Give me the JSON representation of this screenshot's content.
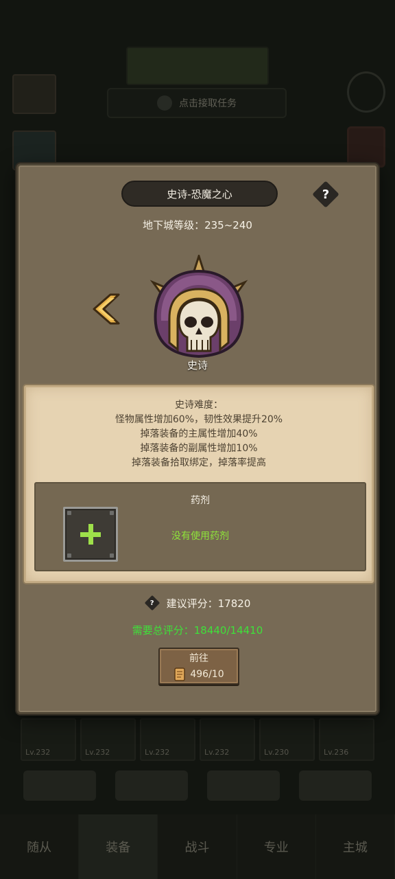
{
  "background": {
    "top_panel_text": [
      "",
      ""
    ],
    "task_bar_text": "点击接取任务",
    "equipment_slots": [
      "Lv.232",
      "Lv.232",
      "Lv.232",
      "Lv.232",
      "Lv.230",
      "Lv.236"
    ],
    "nav_items": [
      "随从",
      "装备",
      "战斗",
      "专业",
      "主城"
    ]
  },
  "dialog": {
    "title": "史诗-恐魔之心",
    "help_symbol": "?",
    "dungeon_level": "地下城等级：235~240",
    "difficulty_tag": "史诗",
    "boss_icon": "skull-helmet-icon",
    "prev_icon": "chevron-left-icon"
  },
  "difficulty": {
    "heading": "史诗难度：",
    "lines": [
      "怪物属性增加60%，韧性效果提升20%",
      "掉落装备的主属性增加40%",
      "掉落装备的副属性增加10%",
      "掉落装备拾取绑定，掉落率提高"
    ]
  },
  "potion": {
    "title": "药剂",
    "empty_text": "没有使用药剂",
    "add_icon": "plus-icon"
  },
  "score": {
    "recommended": "建议评分：17820",
    "required": "需要总评分：18440/14410"
  },
  "go_button": {
    "label": "前往",
    "cost": "496/10",
    "cost_icon": "scroll-icon"
  },
  "colors": {
    "dialog_bg": "#776a55",
    "parchment": "#e6d3b2",
    "green_text": "#3fe03a",
    "plus_green": "#9ee04a"
  }
}
